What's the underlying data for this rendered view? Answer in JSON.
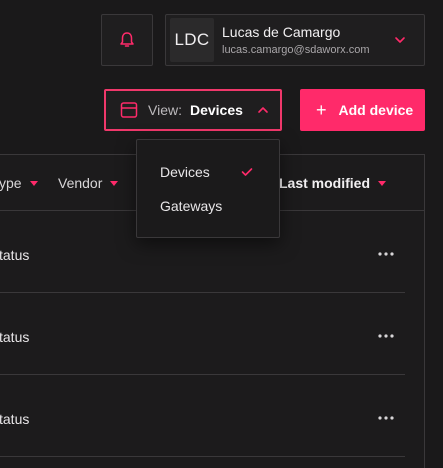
{
  "header": {
    "notifications_icon": "bell-icon",
    "user": {
      "initials": "LDC",
      "name": "Lucas de Camargo",
      "email": "lucas.camargo@sdaworx.com"
    }
  },
  "toolbar": {
    "view_label": "View:",
    "view_value": "Devices",
    "add_label": "Add device"
  },
  "view_menu": {
    "items": [
      {
        "label": "Devices",
        "selected": true
      },
      {
        "label": "Gateways",
        "selected": false
      }
    ]
  },
  "table": {
    "columns": [
      {
        "label": "ype"
      },
      {
        "label": "Vendor"
      },
      {
        "label": "Last modified"
      }
    ],
    "rows": [
      {
        "status": "tatus"
      },
      {
        "status": "tatus"
      },
      {
        "status": "tatus"
      }
    ]
  },
  "colors": {
    "accent": "#ff2a6a",
    "background": "#1a191a",
    "border": "#3a383a"
  }
}
